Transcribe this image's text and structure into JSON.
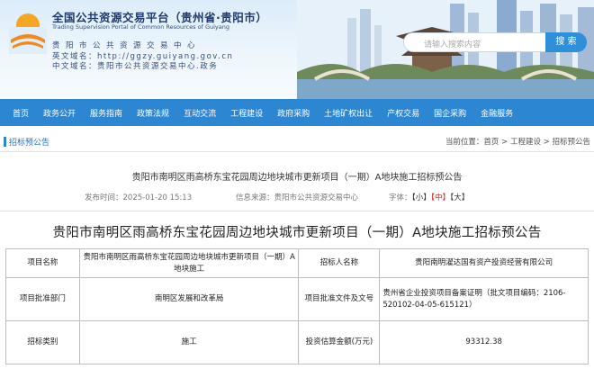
{
  "header": {
    "title": "全国公共资源交易平台（贵州省·贵阳市）",
    "subtitle_en_line1": "Trading Supervision Portal of Common Resources of Guiyang",
    "center_name": "贵阳市公共资源交易中心",
    "domain_en": "英文域名：http://ggzy.guiyang.gov.cn",
    "domain_cn": "中文域名：贵阳市公共资源交易中心.政务",
    "search_placeholder": "请输入搜索内容",
    "search_button": "搜 索"
  },
  "nav": {
    "items": [
      "首页",
      "政务公开",
      "服务指南",
      "政策法规",
      "互动交流",
      "工程建设",
      "政府采购",
      "土地矿权出让",
      "产权交易",
      "国企采购",
      "金融服务"
    ]
  },
  "location": {
    "section": "招标预公告",
    "prefix": "当前位置：",
    "home": "首页",
    "sep1": " > ",
    "level1": "工程建设",
    "sep2": " > ",
    "level2": "招标预公告"
  },
  "article": {
    "title": "贵阳市南明区雨高桥东宝花园周边地块城市更新项目（一期）A地块施工招标预公告",
    "publish_time": "发布时间：2025-01-20 15:13",
    "source": "信息来源：贵阳市公共资源交易中心",
    "font_label": "字体：",
    "font_small": "【小】",
    "font_mid": "【中】",
    "font_large": "【大】",
    "heading": "贵阳市南明区雨高桥东宝花园周边地块城市更新项目（一期）A地块施工招标预公告"
  },
  "table": {
    "rows": [
      [
        "项目名称",
        "贵阳市南明区雨高桥东宝花园周边地块城市更新项目（一期）A地块施工",
        "招标人名称",
        "贵阳南明濯达国有资产投资经营有限公司"
      ],
      [
        "项目批准部门",
        "南明区发展和改革局",
        "项目批准文件及文号",
        "贵州省企业投资项目备案证明（批文项目编码：2106-520102-04-05-615121）"
      ],
      [
        "招标类别",
        "施工",
        "投资估算金额(万元)",
        "93312.38"
      ]
    ]
  },
  "colors": {
    "nav_bg": "#2d86d2",
    "search_btn": "#2f8fd8",
    "title_navy": "#1f3a6b",
    "font_mid_red": "#d22"
  }
}
